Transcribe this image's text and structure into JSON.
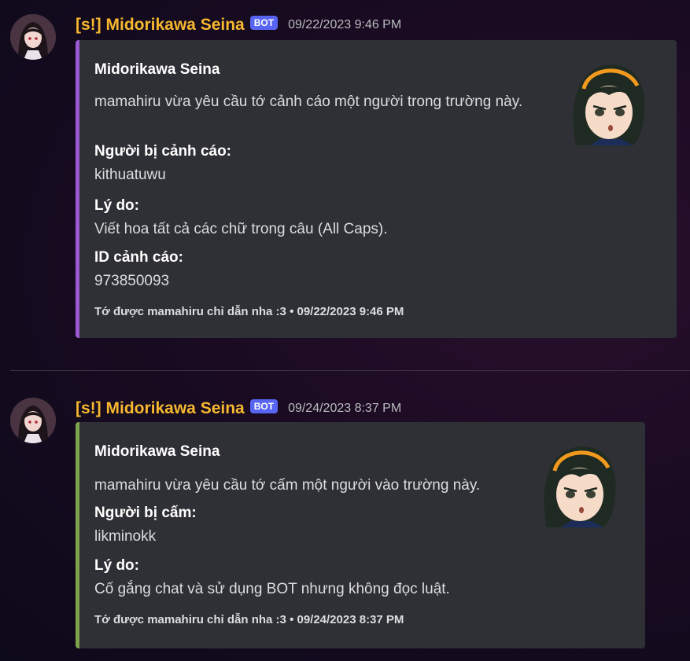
{
  "messages": [
    {
      "author": "[s!] Midorikawa Seina",
      "badge": "BOT",
      "timestamp": "09/22/2023 9:46 PM",
      "embed": {
        "title": "Midorikawa Seina",
        "description": "mamahiru vừa yêu cầu tớ cảnh cáo một người trong trường này.",
        "fields": [
          {
            "name": "Người bị cảnh cáo:",
            "value": "kithuatuwu"
          },
          {
            "name": "Lý do:",
            "value": "Viết hoa tất cả các chữ trong câu (All Caps)."
          },
          {
            "name": "ID cảnh cáo:",
            "value": "973850093"
          }
        ],
        "footer": "Tớ được mamahiru chỉ dẫn nha :3 • 09/22/2023 9:46 PM",
        "accent": "#9b59d6"
      }
    },
    {
      "author": "[s!] Midorikawa Seina",
      "badge": "BOT",
      "timestamp": "09/24/2023 8:37 PM",
      "embed": {
        "title": "Midorikawa Seina",
        "description": "mamahiru vừa yêu cầu tớ cấm một người vào trường này.",
        "fields": [
          {
            "name": "Người bị cấm:",
            "value": "likminokk"
          },
          {
            "name": "Lý do:",
            "value": "Cố gắng chat và sử dụng BOT nhưng không đọc luật."
          }
        ],
        "footer": "Tớ được mamahiru chỉ dẫn nha :3 • 09/24/2023 8:37 PM",
        "accent": "#7fa34d"
      }
    }
  ],
  "icons": {
    "avatar": "bot-avatar",
    "thumbnail": "anime-girl-thumbnail"
  },
  "colors": {
    "username": "#f5b82e",
    "badge": "#5865f2",
    "embed_bg": "#2f3035"
  }
}
